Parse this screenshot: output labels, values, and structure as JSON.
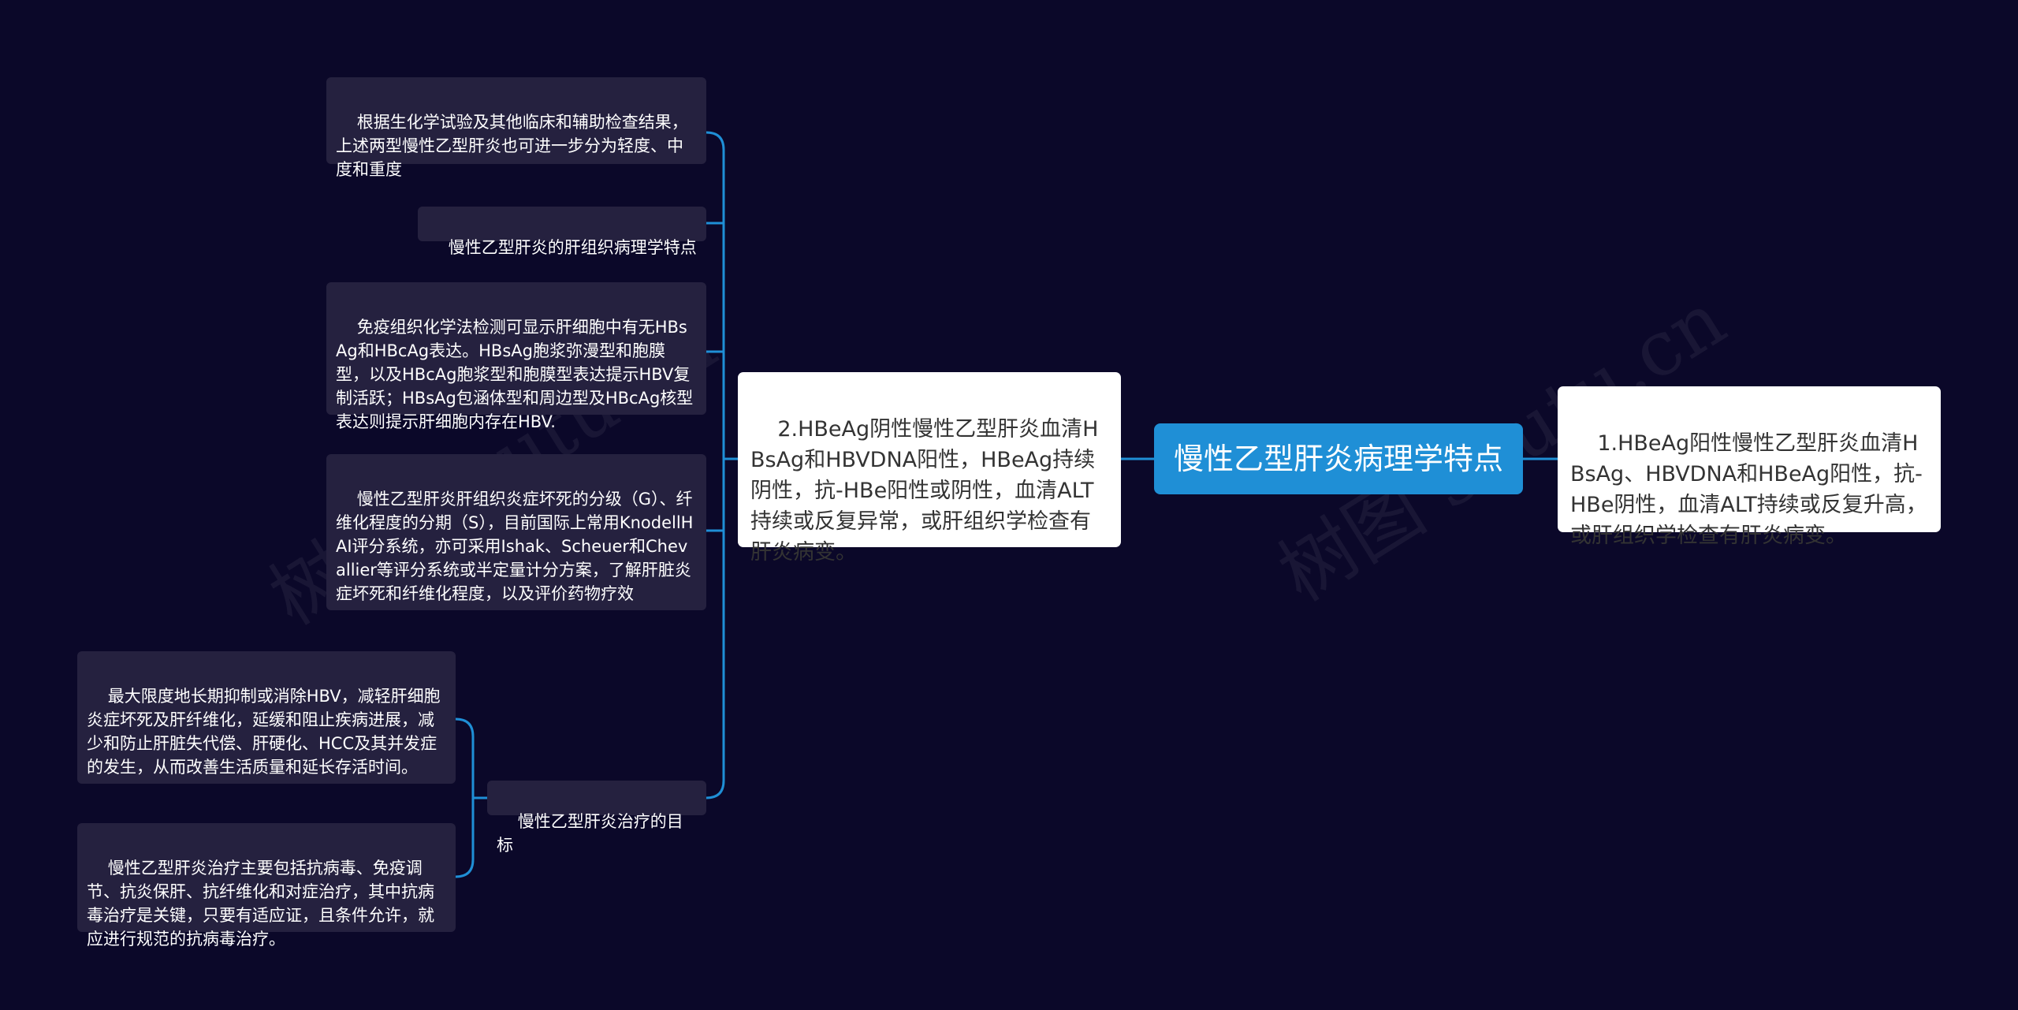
{
  "watermark": "树图 shutu.cn",
  "colors": {
    "background": "#0b0829",
    "connector": "#1f8fd6",
    "root_fill": "#1f8fd6",
    "main_fill": "#ffffff",
    "leaf_fill": "#25213f"
  },
  "root": {
    "text": "慢性乙型肝炎病理学特点"
  },
  "right_branch": {
    "text": "1.HBeAg阳性慢性乙型肝炎血清HBsAg、HBVDNA和HBeAg阳性，抗-HBe阴性，血清ALT持续或反复升高，或肝组织学检查有肝炎病变。"
  },
  "left_branch": {
    "text": "2.HBeAg阴性慢性乙型肝炎血清HBsAg和HBVDNA阳性，HBeAg持续阴性，抗-HBe阳性或阴性，血清ALT持续或反复异常，或肝组织学检查有肝炎病变。",
    "children": [
      {
        "text": "根据生化学试验及其他临床和辅助检查结果，上述两型慢性乙型肝炎也可进一步分为轻度、中度和重度"
      },
      {
        "text": "慢性乙型肝炎的肝组织病理学特点"
      },
      {
        "text": "免疫组织化学法检测可显示肝细胞中有无HBsAg和HBcAg表达。HBsAg胞浆弥漫型和胞膜型，以及HBcAg胞浆型和胞膜型表达提示HBV复制活跃；HBsAg包涵体型和周边型及HBcAg核型表达则提示肝细胞内存在HBV."
      },
      {
        "text": "慢性乙型肝炎肝组织炎症坏死的分级（G）、纤维化程度的分期（S），目前国际上常用KnodellHAI评分系统，亦可采用Ishak、Scheuer和Chevallier等评分系统或半定量计分方案，了解肝脏炎症坏死和纤维化程度，以及评价药物疗效"
      },
      {
        "text": "慢性乙型肝炎治疗的目标",
        "children": [
          {
            "text": "最大限度地长期抑制或消除HBV，减轻肝细胞炎症坏死及肝纤维化，延缓和阻止疾病进展，减少和防止肝脏失代偿、肝硬化、HCC及其并发症的发生，从而改善生活质量和延长存活时间。"
          },
          {
            "text": "慢性乙型肝炎治疗主要包括抗病毒、免疫调节、抗炎保肝、抗纤维化和对症治疗，其中抗病毒治疗是关键，只要有适应证，且条件允许，就应进行规范的抗病毒治疗。"
          }
        ]
      }
    ]
  }
}
